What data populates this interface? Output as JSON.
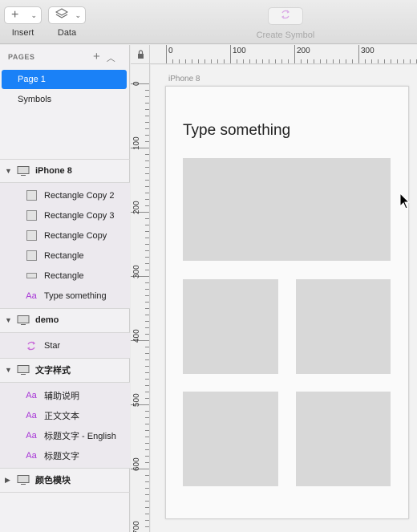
{
  "toolbar": {
    "insert_label": "Insert",
    "data_label": "Data",
    "create_symbol_label": "Create Symbol"
  },
  "pages": {
    "header": "PAGES",
    "items": [
      {
        "label": "Page 1",
        "selected": true
      },
      {
        "label": "Symbols",
        "selected": false
      }
    ]
  },
  "layers": {
    "artboards": [
      {
        "name": "iPhone 8",
        "expanded": true,
        "children": [
          "Rectangle Copy 2",
          "Rectangle Copy 3",
          "Rectangle Copy",
          "Rectangle",
          "Rectangle",
          "Type something"
        ]
      },
      {
        "name": "demo",
        "expanded": true,
        "children": [
          "Star"
        ]
      },
      {
        "name": "文字样式",
        "expanded": true,
        "children": [
          "辅助说明",
          "正文文本",
          "标题文字 - English",
          "标题文字"
        ]
      },
      {
        "name": "颜色模块",
        "expanded": false,
        "children": []
      }
    ]
  },
  "rulers": {
    "top": [
      "0",
      "100",
      "200",
      "300"
    ],
    "left": [
      "0",
      "100",
      "200",
      "300",
      "400",
      "500",
      "600",
      "700"
    ]
  },
  "canvas": {
    "artboard_title": "iPhone 8",
    "heading": "Type something"
  },
  "colors": {
    "selection": "#1a81f7",
    "text_style_icon": "#a633d6",
    "symbol_icon": "#c86ad8",
    "placeholder_rect": "#d8d8d8"
  }
}
